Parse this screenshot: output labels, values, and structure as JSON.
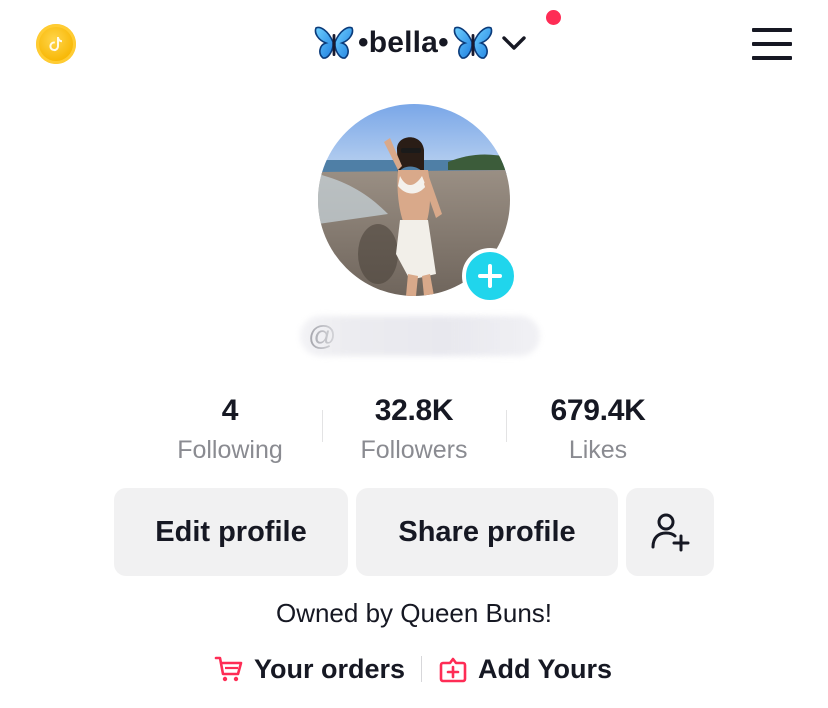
{
  "header": {
    "username": "•bella•",
    "left_icon": "tiktok-coin-icon",
    "title_icons": [
      "butterfly-emoji",
      "chevron-down-icon"
    ],
    "notification_dot": true,
    "menu_icon": "hamburger-menu-icon",
    "accent_color": "#fe2c55"
  },
  "profile": {
    "handle_prefix": "@",
    "handle_redacted": true,
    "avatar_add_icon": "plus-icon",
    "avatar_add_color": "#20d5ec"
  },
  "stats": [
    {
      "value": "4",
      "label": "Following"
    },
    {
      "value": "32.8K",
      "label": "Followers"
    },
    {
      "value": "679.4K",
      "label": "Likes"
    }
  ],
  "actions": {
    "edit_profile": "Edit profile",
    "share_profile": "Share profile",
    "add_friend_icon": "add-friend-icon"
  },
  "bio": "Owned by Queen Buns!",
  "links": {
    "orders_label": "Your orders",
    "orders_icon": "shopping-cart-icon",
    "add_yours_label": "Add Yours",
    "add_yours_icon": "add-square-icon",
    "icon_color": "#fe2c55"
  }
}
